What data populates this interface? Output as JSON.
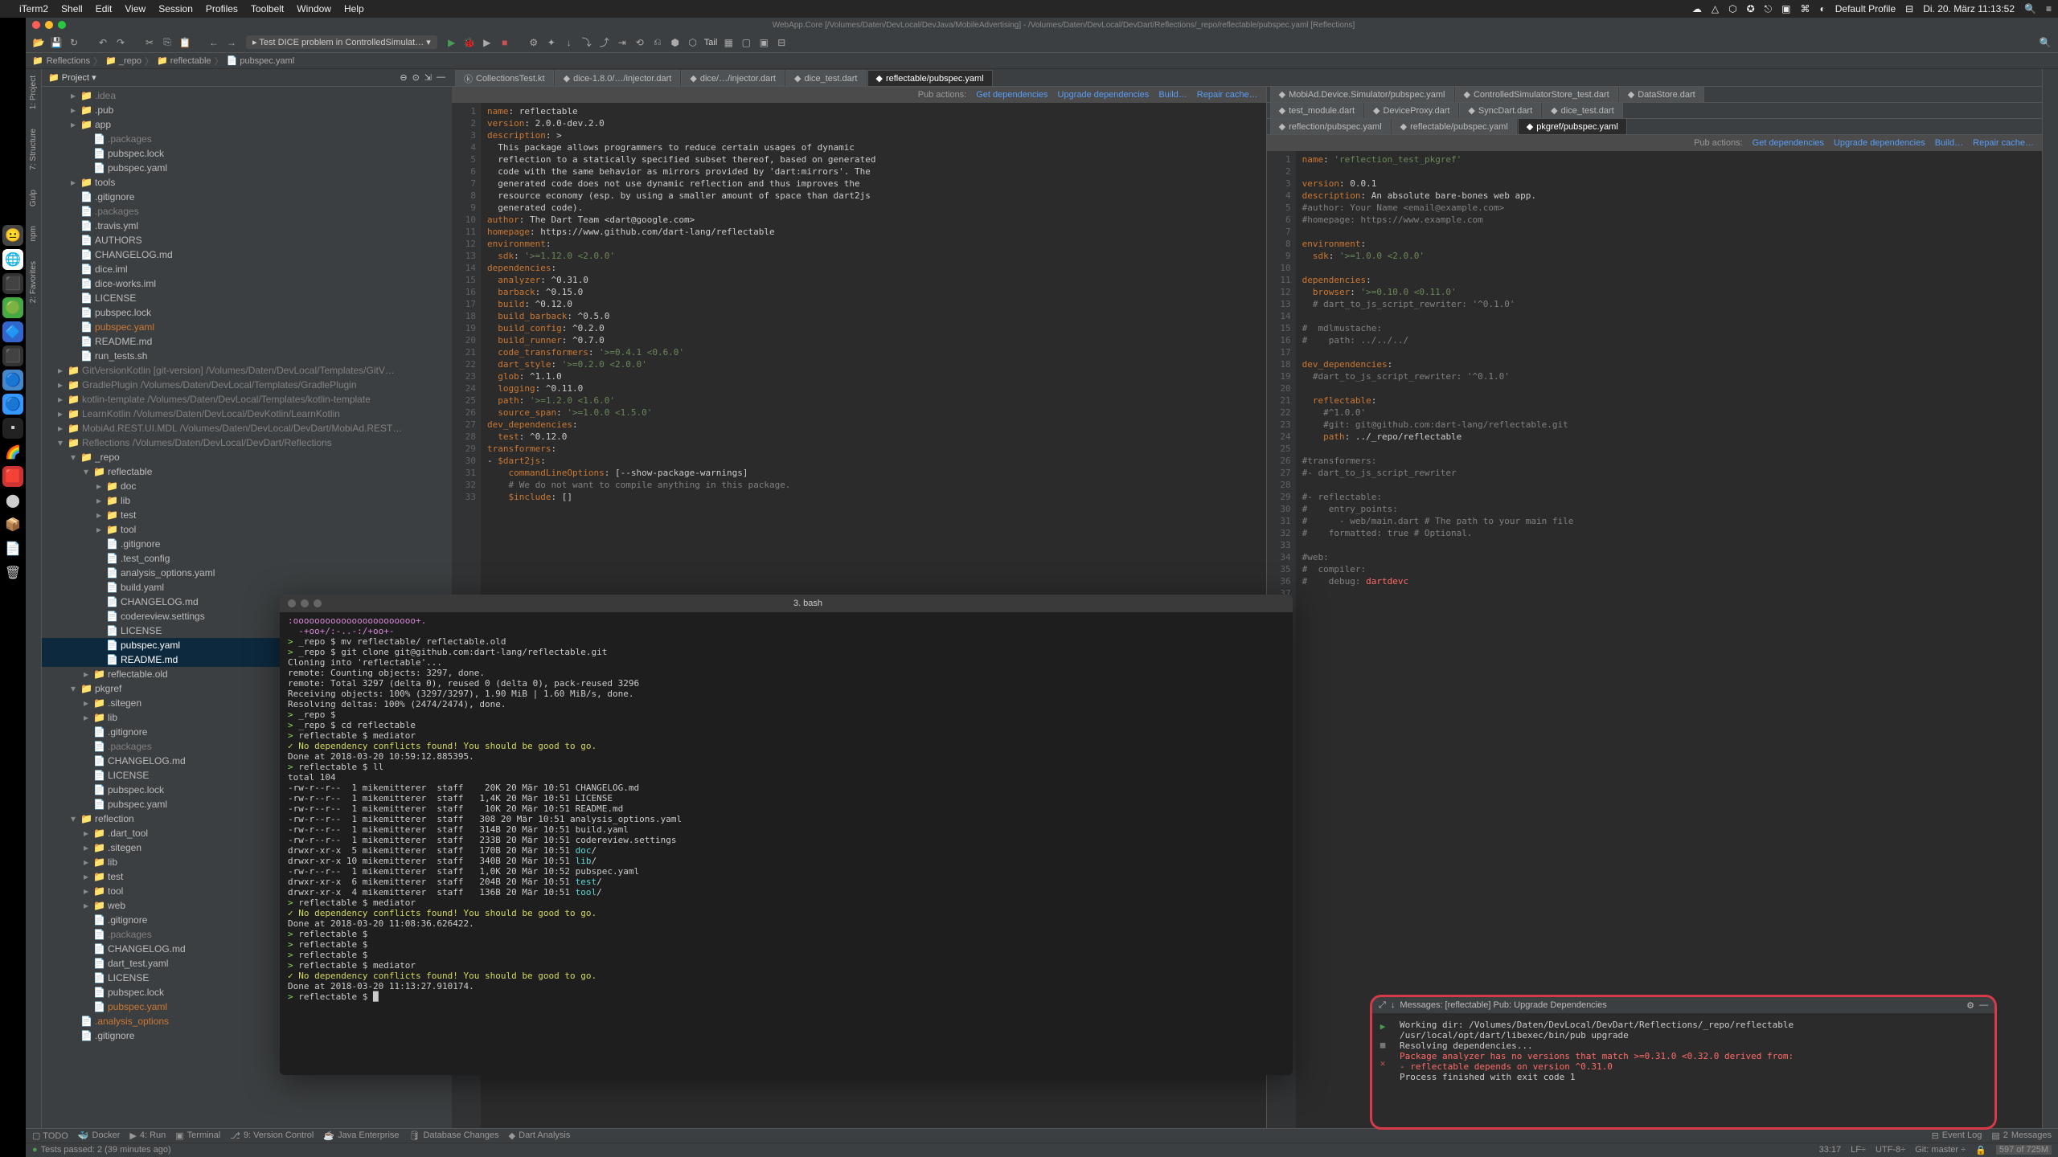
{
  "macos": {
    "app": "iTerm2",
    "menus": [
      "Shell",
      "Edit",
      "View",
      "Session",
      "Profiles",
      "Toolbelt",
      "Window",
      "Help"
    ],
    "right": [
      "Default Profile",
      "Di. 20. März  11:13:52"
    ]
  },
  "ide": {
    "title": "WebApp.Core [/Volumes/Daten/DevLocal/DevJava/MobileAdvertising] - /Volumes/Daten/DevLocal/DevDart/Reflections/_repo/reflectable/pubspec.yaml [Reflections]",
    "run_config": "Test DICE problem in ControlledSimulat…",
    "tail_label": "Tail",
    "breadcrumb": [
      "Reflections",
      "_repo",
      "reflectable",
      "pubspec.yaml"
    ],
    "project_label": "Project",
    "tree": [
      {
        "l": 1,
        "c": "▸",
        "i": "📁",
        "t": ".idea",
        "dim": true
      },
      {
        "l": 1,
        "c": "▸",
        "i": "📁",
        "t": ".pub"
      },
      {
        "l": 1,
        "c": "▸",
        "i": "📁",
        "t": "app"
      },
      {
        "l": 2,
        "c": "",
        "i": "📄",
        "t": ".packages",
        "dim": true
      },
      {
        "l": 2,
        "c": "",
        "i": "📄",
        "t": "pubspec.lock"
      },
      {
        "l": 2,
        "c": "",
        "i": "📄",
        "t": "pubspec.yaml"
      },
      {
        "l": 1,
        "c": "▸",
        "i": "📁",
        "t": "tools"
      },
      {
        "l": 1,
        "c": "",
        "i": "📄",
        "t": ".gitignore"
      },
      {
        "l": 1,
        "c": "",
        "i": "📄",
        "t": ".packages",
        "dim": true
      },
      {
        "l": 1,
        "c": "",
        "i": "📄",
        "t": ".travis.yml"
      },
      {
        "l": 1,
        "c": "",
        "i": "📄",
        "t": "AUTHORS"
      },
      {
        "l": 1,
        "c": "",
        "i": "📄",
        "t": "CHANGELOG.md"
      },
      {
        "l": 1,
        "c": "",
        "i": "📄",
        "t": "dice.iml"
      },
      {
        "l": 1,
        "c": "",
        "i": "📄",
        "t": "dice-works.iml"
      },
      {
        "l": 1,
        "c": "",
        "i": "📄",
        "t": "LICENSE"
      },
      {
        "l": 1,
        "c": "",
        "i": "📄",
        "t": "pubspec.lock"
      },
      {
        "l": 1,
        "c": "",
        "i": "📄",
        "t": "pubspec.yaml",
        "orange": true
      },
      {
        "l": 1,
        "c": "",
        "i": "📄",
        "t": "README.md"
      },
      {
        "l": 1,
        "c": "",
        "i": "📄",
        "t": "run_tests.sh"
      },
      {
        "l": 0,
        "c": "▸",
        "i": "📁",
        "t": "GitVersionKotlin [git-version]  /Volumes/Daten/DevLocal/Templates/GitV…",
        "dim": true
      },
      {
        "l": 0,
        "c": "▸",
        "i": "📁",
        "t": "GradlePlugin  /Volumes/Daten/DevLocal/Templates/GradlePlugin",
        "dim": true
      },
      {
        "l": 0,
        "c": "▸",
        "i": "📁",
        "t": "kotlin-template  /Volumes/Daten/DevLocal/Templates/kotlin-template",
        "dim": true
      },
      {
        "l": 0,
        "c": "▸",
        "i": "📁",
        "t": "LearnKotlin  /Volumes/Daten/DevLocal/DevKotlin/LearnKotlin",
        "dim": true
      },
      {
        "l": 0,
        "c": "▸",
        "i": "📁",
        "t": "MobiAd.REST.UI.MDL  /Volumes/Daten/DevLocal/DevDart/MobiAd.REST…",
        "dim": true
      },
      {
        "l": 0,
        "c": "▾",
        "i": "📁",
        "t": "Reflections  /Volumes/Daten/DevLocal/DevDart/Reflections",
        "dim": true
      },
      {
        "l": 1,
        "c": "▾",
        "i": "📁",
        "t": "_repo"
      },
      {
        "l": 2,
        "c": "▾",
        "i": "📁",
        "t": "reflectable"
      },
      {
        "l": 3,
        "c": "▸",
        "i": "📁",
        "t": "doc"
      },
      {
        "l": 3,
        "c": "▸",
        "i": "📁",
        "t": "lib"
      },
      {
        "l": 3,
        "c": "▸",
        "i": "📁",
        "t": "test"
      },
      {
        "l": 3,
        "c": "▸",
        "i": "📁",
        "t": "tool"
      },
      {
        "l": 3,
        "c": "",
        "i": "📄",
        "t": ".gitignore"
      },
      {
        "l": 3,
        "c": "",
        "i": "📄",
        "t": ".test_config"
      },
      {
        "l": 3,
        "c": "",
        "i": "📄",
        "t": "analysis_options.yaml"
      },
      {
        "l": 3,
        "c": "",
        "i": "📄",
        "t": "build.yaml"
      },
      {
        "l": 3,
        "c": "",
        "i": "📄",
        "t": "CHANGELOG.md"
      },
      {
        "l": 3,
        "c": "",
        "i": "📄",
        "t": "codereview.settings"
      },
      {
        "l": 3,
        "c": "",
        "i": "📄",
        "t": "LICENSE"
      },
      {
        "l": 3,
        "c": "",
        "i": "📄",
        "t": "pubspec.yaml",
        "selected": true
      },
      {
        "l": 3,
        "c": "",
        "i": "📄",
        "t": "README.md",
        "selected": true
      },
      {
        "l": 2,
        "c": "▸",
        "i": "📁",
        "t": "reflectable.old"
      },
      {
        "l": 1,
        "c": "▾",
        "i": "📁",
        "t": "pkgref"
      },
      {
        "l": 2,
        "c": "▸",
        "i": "📁",
        "t": ".sitegen"
      },
      {
        "l": 2,
        "c": "▸",
        "i": "📁",
        "t": "lib"
      },
      {
        "l": 2,
        "c": "",
        "i": "📄",
        "t": ".gitignore"
      },
      {
        "l": 2,
        "c": "",
        "i": "📄",
        "t": ".packages",
        "dim": true
      },
      {
        "l": 2,
        "c": "",
        "i": "📄",
        "t": "CHANGELOG.md"
      },
      {
        "l": 2,
        "c": "",
        "i": "📄",
        "t": "LICENSE"
      },
      {
        "l": 2,
        "c": "",
        "i": "📄",
        "t": "pubspec.lock"
      },
      {
        "l": 2,
        "c": "",
        "i": "📄",
        "t": "pubspec.yaml"
      },
      {
        "l": 1,
        "c": "▾",
        "i": "📁",
        "t": "reflection"
      },
      {
        "l": 2,
        "c": "▸",
        "i": "📁",
        "t": ".dart_tool"
      },
      {
        "l": 2,
        "c": "▸",
        "i": "📁",
        "t": ".sitegen"
      },
      {
        "l": 2,
        "c": "▸",
        "i": "📁",
        "t": "lib"
      },
      {
        "l": 2,
        "c": "▸",
        "i": "📁",
        "t": "test"
      },
      {
        "l": 2,
        "c": "▸",
        "i": "📁",
        "t": "tool"
      },
      {
        "l": 2,
        "c": "▸",
        "i": "📁",
        "t": "web"
      },
      {
        "l": 2,
        "c": "",
        "i": "📄",
        "t": ".gitignore"
      },
      {
        "l": 2,
        "c": "",
        "i": "📄",
        "t": ".packages",
        "dim": true
      },
      {
        "l": 2,
        "c": "",
        "i": "📄",
        "t": "CHANGELOG.md"
      },
      {
        "l": 2,
        "c": "",
        "i": "📄",
        "t": "dart_test.yaml"
      },
      {
        "l": 2,
        "c": "",
        "i": "📄",
        "t": "LICENSE"
      },
      {
        "l": 2,
        "c": "",
        "i": "📄",
        "t": "pubspec.lock"
      },
      {
        "l": 2,
        "c": "",
        "i": "📄",
        "t": "pubspec.yaml",
        "orange": true
      },
      {
        "l": 1,
        "c": "",
        "i": "📄",
        "t": ".analysis_options",
        "orange": true
      },
      {
        "l": 1,
        "c": "",
        "i": "📄",
        "t": ".gitignore"
      }
    ],
    "tabs_left": [
      "CollectionsTest.kt",
      "dice-1.8.0/…/injector.dart",
      "dice/…/injector.dart",
      "dice_test.dart",
      "reflectable/pubspec.yaml"
    ],
    "tabs_right_top": [
      "MobiAd.Device.Simulator/pubspec.yaml",
      "ControlledSimulatorStore_test.dart",
      "DataStore.dart"
    ],
    "tabs_right_sub": [
      "test_module.dart",
      "DeviceProxy.dart",
      "SyncDart.dart",
      "dice_test.dart"
    ],
    "tabs_right_sub2": [
      "reflection/pubspec.yaml",
      "reflectable/pubspec.yaml",
      "pkgref/pubspec.yaml"
    ],
    "pub_actions": {
      "label": "Pub actions:",
      "links": [
        "Get dependencies",
        "Upgrade dependencies",
        "Build…",
        "Repair cache…"
      ]
    },
    "code_left": [
      "<k>name</k>: reflectable",
      "<k>version</k>: 2.0.0-dev.2.0",
      "<k>description</k>: >",
      "  This package allows programmers to reduce certain usages of dynamic",
      "  reflection to a statically specified subset thereof, based on generated",
      "  code with the same behavior as mirrors provided by 'dart:mirrors'. The",
      "  generated code does not use dynamic reflection and thus improves the",
      "  resource economy (esp. by using a smaller amount of space than dart2js",
      "  generated code).",
      "<k>author</k>: The Dart Team &lt;dart@google.com&gt;",
      "<k>homepage</k>: https://www.github.com/dart-lang/reflectable",
      "<k>environment</k>:",
      "  <k>sdk</k>: <s>'&gt;=1.12.0 &lt;2.0.0'</s>",
      "<k>dependencies</k>:",
      "  <k>analyzer</k>: ^0.31.0",
      "  <k>barback</k>: ^0.15.0",
      "  <k>build</k>: ^0.12.0",
      "  <k>build_barback</k>: ^0.5.0",
      "  <k>build_config</k>: ^0.2.0",
      "  <k>build_runner</k>: ^0.7.0",
      "  <k>code_transformers</k>: <s>'&gt;=0.4.1 &lt;0.6.0'</s>",
      "  <k>dart_style</k>: <s>'&gt;=0.2.0 &lt;2.0.0'</s>",
      "  <k>glob</k>: ^1.1.0",
      "  <k>logging</k>: ^0.11.0",
      "  <k>path</k>: <s>'&gt;=1.2.0 &lt;1.6.0'</s>",
      "  <k>source_span</k>: <s>'&gt;=1.0.0 &lt;1.5.0'</s>",
      "<k>dev_dependencies</k>:",
      "  <k>test</k>: ^0.12.0",
      "<k>transformers</k>:",
      "- <k>$dart2js</k>:",
      "    <k>commandLineOptions</k>: [--show-package-warnings]",
      "    <c># We do not want to compile anything in this package.</c>",
      "    <k>$include</k>: []"
    ],
    "code_right": [
      "<k>name</k>: <s>'reflection_test_pkgref'</s>",
      "",
      "<k>version</k>: 0.0.1",
      "<k>description</k>: An absolute bare-bones web app.",
      "<c>#author: Your Name &lt;email@example.com&gt;</c>",
      "<c>#homepage: https://www.example.com</c>",
      "",
      "<k>environment</k>:",
      "  <k>sdk</k>: <s>'&gt;=1.0.0 &lt;2.0.0'</s>",
      "",
      "<k>dependencies</k>:",
      "  <k>browser</k>: <s>'&gt;=0.10.0 &lt;0.11.0'</s>",
      "  <c># dart_to_js_script_rewriter: '^0.1.0'</c>",
      "",
      "<c>#  mdlmustache:</c>",
      "<c>#    path: ../../../</c>",
      "",
      "<k>dev_dependencies</k>:",
      "  <c>#dart_to_js_script_rewriter: '^0.1.0'</c>",
      "",
      "  <k>reflectable</k>:",
      "    <c>#^1.0.0'</c>",
      "    <c>#git: git@github.com:dart-lang/reflectable.git</c>",
      "    <k>path</k>: ../_repo/reflectable",
      "",
      "<c>#transformers:</c>",
      "<c>#- dart_to_js_script_rewriter</c>",
      "",
      "<c>#- reflectable:</c>",
      "<c>#    entry_points:</c>",
      "<c>#      - web/main.dart # The path to your main file</c>",
      "<c>#    formatted: true # Optional.</c>",
      "",
      "<c>#web:</c>",
      "<c>#  compiler:</c>",
      "<c>#    debug: </c><err>dartdevc</err>",
      ""
    ],
    "bottom_panels": [
      "Docker",
      "4: Run",
      "Terminal",
      "9: Version Control",
      "Java Enterprise",
      "Database Changes",
      "Dart Analysis"
    ],
    "tests_passed": "Tests passed: 2 (39 minutes ago)",
    "status_right": [
      "33:17",
      "LF÷",
      "UTF-8÷",
      "Git: master ÷"
    ],
    "event_log": "Event Log",
    "messages_label": "Messages",
    "messages_count": "2"
  },
  "terminal": {
    "title": "3. bash",
    "lines": [
      "<span class='term-magenta'>:ooooooooooooooooooooooo+.</span>",
      "  <span class='term-magenta'>-+oo+/:-..-:/+oo+-</span>",
      "<span class='term-green'>&gt; </span>_repo $ mv reflectable/ reflectable.old",
      "<span class='term-green'>&gt; </span>_repo $ git clone git@github.com:dart-lang/reflectable.git",
      "Cloning into 'reflectable'...",
      "remote: Counting objects: 3297, done.",
      "remote: Total 3297 (delta 0), reused 0 (delta 0), pack-reused 3296",
      "Receiving objects: 100% (3297/3297), 1.90 MiB | 1.60 MiB/s, done.",
      "Resolving deltas: 100% (2474/2474), done.",
      "<span class='term-green'>&gt; </span>_repo $",
      "<span class='term-green'>&gt; </span>_repo $ cd reflectable",
      "<span class='term-green'>&gt; </span>reflectable $ mediator",
      "<span class='term-yellow'>✓ No dependency conflicts found! You should be good to go.</span>",
      "Done at 2018-03-20 10:59:12.885395.",
      "<span class='term-green'>&gt; </span>reflectable $ ll",
      "total 104",
      "-rw-r--r--  1 mikemitterer  staff    20K 20 Mär 10:51 CHANGELOG.md",
      "-rw-r--r--  1 mikemitterer  staff   1,4K 20 Mär 10:51 LICENSE",
      "-rw-r--r--  1 mikemitterer  staff    10K 20 Mär 10:51 README.md",
      "-rw-r--r--  1 mikemitterer  staff   308 20 Mär 10:51 analysis_options.yaml",
      "-rw-r--r--  1 mikemitterer  staff   314B 20 Mär 10:51 build.yaml",
      "-rw-r--r--  1 mikemitterer  staff   233B 20 Mär 10:51 codereview.settings",
      "drwxr-xr-x  5 mikemitterer  staff   170B 20 Mär 10:51 <span class='term-cyan'>doc</span>/",
      "drwxr-xr-x 10 mikemitterer  staff   340B 20 Mär 10:51 <span class='term-cyan'>lib</span>/",
      "-rw-r--r--  1 mikemitterer  staff   1,0K 20 Mär 10:52 pubspec.yaml",
      "drwxr-xr-x  6 mikemitterer  staff   204B 20 Mär 10:51 <span class='term-cyan'>test</span>/",
      "drwxr-xr-x  4 mikemitterer  staff   136B 20 Mär 10:51 <span class='term-cyan'>tool</span>/",
      "<span class='term-green'>&gt; </span>reflectable $ mediator",
      "<span class='term-yellow'>✓ No dependency conflicts found! You should be good to go.</span>",
      "Done at 2018-03-20 11:08:36.626422.",
      "<span class='term-green'>&gt; </span>reflectable $",
      "<span class='term-green'>&gt; </span>reflectable $",
      "<span class='term-green'>&gt; </span>reflectable $",
      "<span class='term-green'>&gt; </span>reflectable $ mediator",
      "<span class='term-yellow'>✓ No dependency conflicts found! You should be good to go.</span>",
      "Done at 2018-03-20 11:13:27.910174.",
      "<span class='term-green'>&gt; </span>reflectable $ █"
    ]
  },
  "messages": {
    "header": "Messages:    [reflectable] Pub: Upgrade Dependencies",
    "lines": [
      "Working dir: /Volumes/Daten/DevLocal/DevDart/Reflections/_repo/reflectable",
      "/usr/local/opt/dart/libexec/bin/pub upgrade",
      "Resolving dependencies...",
      "<r>Package analyzer has no versions that match &gt;=0.31.0 &lt;0.32.0 derived from:</r>",
      "<r>- reflectable depends on version ^0.31.0</r>",
      "Process finished with exit code 1"
    ]
  }
}
